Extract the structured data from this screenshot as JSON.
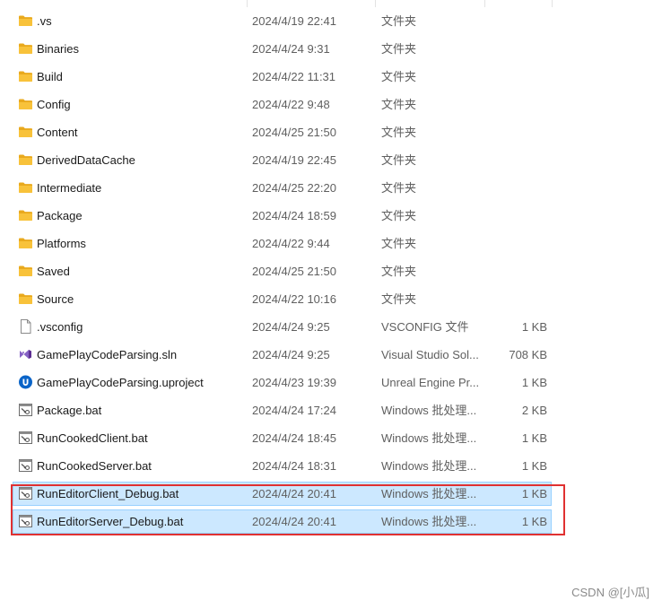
{
  "files": [
    {
      "name": ".vs",
      "date": "2024/4/19 22:41",
      "type": "文件夹",
      "size": "",
      "icon": "folder-icon"
    },
    {
      "name": "Binaries",
      "date": "2024/4/24 9:31",
      "type": "文件夹",
      "size": "",
      "icon": "folder-icon"
    },
    {
      "name": "Build",
      "date": "2024/4/22 11:31",
      "type": "文件夹",
      "size": "",
      "icon": "folder-icon"
    },
    {
      "name": "Config",
      "date": "2024/4/22 9:48",
      "type": "文件夹",
      "size": "",
      "icon": "folder-icon"
    },
    {
      "name": "Content",
      "date": "2024/4/25 21:50",
      "type": "文件夹",
      "size": "",
      "icon": "folder-icon"
    },
    {
      "name": "DerivedDataCache",
      "date": "2024/4/19 22:45",
      "type": "文件夹",
      "size": "",
      "icon": "folder-icon"
    },
    {
      "name": "Intermediate",
      "date": "2024/4/25 22:20",
      "type": "文件夹",
      "size": "",
      "icon": "folder-icon"
    },
    {
      "name": "Package",
      "date": "2024/4/24 18:59",
      "type": "文件夹",
      "size": "",
      "icon": "folder-icon"
    },
    {
      "name": "Platforms",
      "date": "2024/4/22 9:44",
      "type": "文件夹",
      "size": "",
      "icon": "folder-icon"
    },
    {
      "name": "Saved",
      "date": "2024/4/25 21:50",
      "type": "文件夹",
      "size": "",
      "icon": "folder-icon"
    },
    {
      "name": "Source",
      "date": "2024/4/22 10:16",
      "type": "文件夹",
      "size": "",
      "icon": "folder-icon"
    },
    {
      "name": ".vsconfig",
      "date": "2024/4/24 9:25",
      "type": "VSCONFIG 文件",
      "size": "1 KB",
      "icon": "document-icon"
    },
    {
      "name": "GamePlayCodeParsing.sln",
      "date": "2024/4/24 9:25",
      "type": "Visual Studio Sol...",
      "size": "708 KB",
      "icon": "visual-studio-icon"
    },
    {
      "name": "GamePlayCodeParsing.uproject",
      "date": "2024/4/23 19:39",
      "type": "Unreal Engine Pr...",
      "size": "1 KB",
      "icon": "unreal-engine-icon"
    },
    {
      "name": "Package.bat",
      "date": "2024/4/24 17:24",
      "type": "Windows 批处理...",
      "size": "2 KB",
      "icon": "batch-file-icon"
    },
    {
      "name": "RunCookedClient.bat",
      "date": "2024/4/24 18:45",
      "type": "Windows 批处理...",
      "size": "1 KB",
      "icon": "batch-file-icon"
    },
    {
      "name": "RunCookedServer.bat",
      "date": "2024/4/24 18:31",
      "type": "Windows 批处理...",
      "size": "1 KB",
      "icon": "batch-file-icon"
    },
    {
      "name": "RunEditorClient_Debug.bat",
      "date": "2024/4/24 20:41",
      "type": "Windows 批处理...",
      "size": "1 KB",
      "icon": "batch-file-icon",
      "selected": true
    },
    {
      "name": "RunEditorServer_Debug.bat",
      "date": "2024/4/24 20:41",
      "type": "Windows 批处理...",
      "size": "1 KB",
      "icon": "batch-file-icon",
      "selected": true
    }
  ],
  "watermark": "CSDN @[小瓜]",
  "colors": {
    "folder": "#f8c23a",
    "selection": "#cce8ff",
    "annotation": "#e03131"
  }
}
